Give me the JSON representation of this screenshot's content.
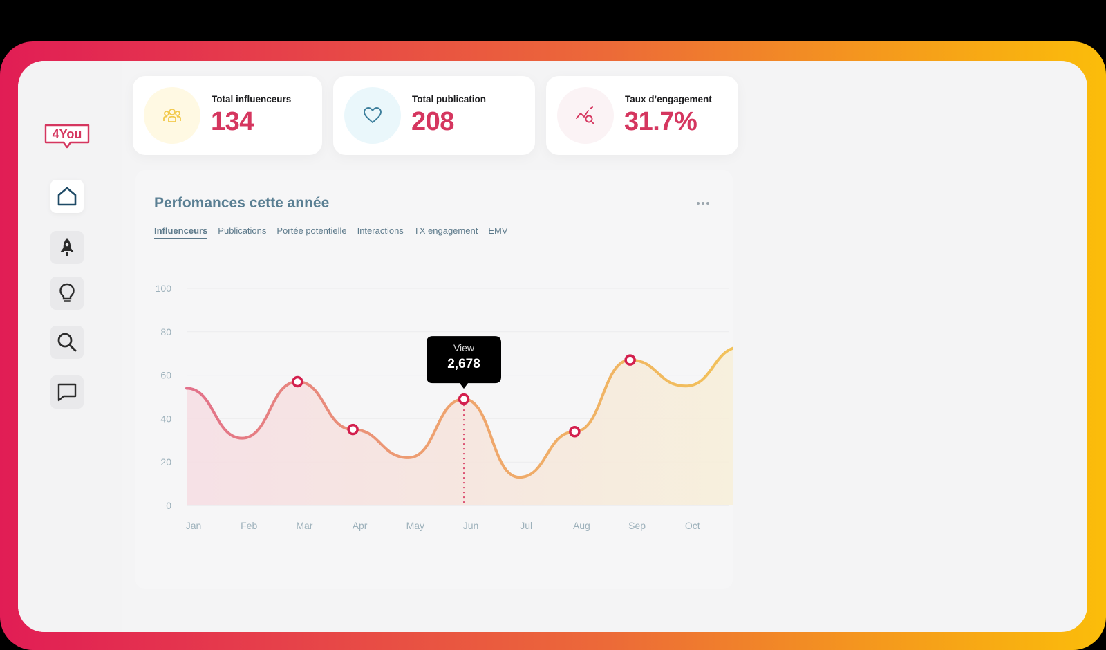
{
  "app": {
    "logo_text": "4You"
  },
  "sidebar": {
    "items": [
      {
        "label": "Home",
        "icon": "home-icon",
        "active": true
      },
      {
        "label": "Campaigns",
        "icon": "rocket-icon",
        "active": false
      },
      {
        "label": "Ideas",
        "icon": "lightbulb-icon",
        "active": false
      },
      {
        "label": "Search",
        "icon": "search-icon",
        "active": false
      },
      {
        "label": "Messages",
        "icon": "chat-icon",
        "active": false
      }
    ]
  },
  "stats": [
    {
      "label": "Total influenceurs",
      "value": "134",
      "icon": "users-icon",
      "icon_color": "#f2c94c",
      "icon_bg": "#fff9e3"
    },
    {
      "label": "Total publication",
      "value": "208",
      "icon": "heart-icon",
      "icon_color": "#3d7f9c",
      "icon_bg": "#eaf7fb"
    },
    {
      "label": "Taux d’engagement",
      "value": "31.7%",
      "icon": "trend-search-icon",
      "icon_color": "#d5365f",
      "icon_bg": "#fbf3f5"
    }
  ],
  "panel": {
    "title": "Perfomances cette année",
    "tabs": [
      "Influenceurs",
      "Publications",
      "Portée potentielle",
      "Interactions",
      "TX engagement",
      "EMV"
    ],
    "active_tab": "Influenceurs"
  },
  "colors": {
    "brand": "#d5365f",
    "line_start": "#e2708a",
    "line_end": "#f2c35a",
    "marker": "#d3204e"
  },
  "chart_data": {
    "type": "line",
    "categories": [
      "Jan",
      "Feb",
      "Mar",
      "Apr",
      "May",
      "Jun",
      "Jul",
      "Aug",
      "Sep",
      "Oct"
    ],
    "x": [
      0,
      1,
      2,
      3,
      4,
      5,
      6,
      7,
      8,
      9,
      10
    ],
    "y": [
      54,
      31,
      57,
      35,
      22,
      49,
      13,
      34,
      67,
      55,
      73
    ],
    "markers_at": [
      2,
      3,
      5,
      7,
      8
    ],
    "ylim": [
      0,
      100
    ],
    "yticks": [
      0,
      20,
      40,
      60,
      80,
      100
    ],
    "grid": true,
    "tooltip": {
      "label": "View",
      "value": "2,678",
      "point_index": 5
    }
  }
}
